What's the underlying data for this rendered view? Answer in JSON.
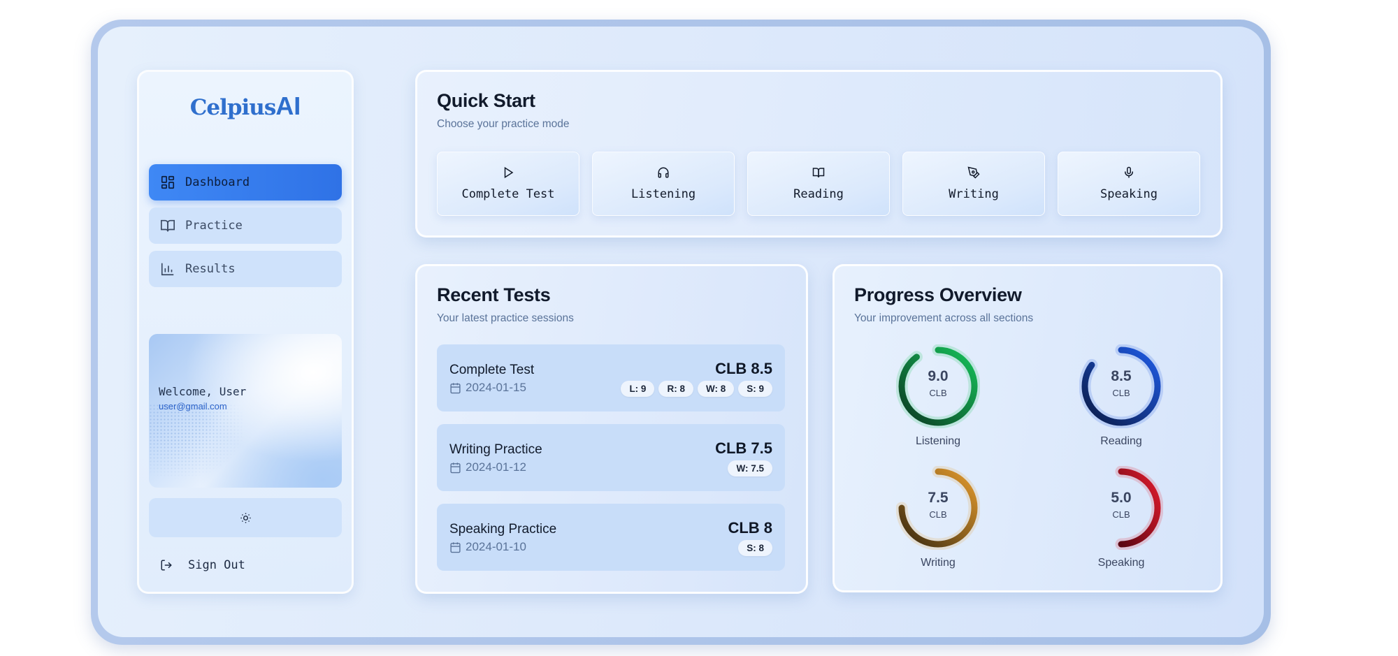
{
  "brand": {
    "logo_main": "Celpius",
    "logo_ai": "AI"
  },
  "sidebar": {
    "items": [
      {
        "label": "Dashboard",
        "icon": "dashboard-icon",
        "active": true
      },
      {
        "label": "Practice",
        "icon": "book-icon",
        "active": false
      },
      {
        "label": "Results",
        "icon": "bar-chart-icon",
        "active": false
      }
    ],
    "user": {
      "welcome": "Welcome, User",
      "email": "user@gmail.com"
    },
    "theme_toggle_icon": "sun-icon",
    "sign_out_label": "Sign Out"
  },
  "quick_start": {
    "title": "Quick Start",
    "subtitle": "Choose your practice mode",
    "modes": [
      {
        "label": "Complete Test",
        "icon": "play-icon"
      },
      {
        "label": "Listening",
        "icon": "headphones-icon"
      },
      {
        "label": "Reading",
        "icon": "book-open-icon"
      },
      {
        "label": "Writing",
        "icon": "pen-icon"
      },
      {
        "label": "Speaking",
        "icon": "microphone-icon"
      }
    ]
  },
  "recent_tests": {
    "title": "Recent Tests",
    "subtitle": "Your latest practice sessions",
    "tests": [
      {
        "name": "Complete Test",
        "date": "2024-01-15",
        "score": "CLB 8.5",
        "badges": [
          "L: 9",
          "R: 8",
          "W: 8",
          "S: 9"
        ]
      },
      {
        "name": "Writing Practice",
        "date": "2024-01-12",
        "score": "CLB 7.5",
        "badges": [
          "W: 7.5"
        ]
      },
      {
        "name": "Speaking Practice",
        "date": "2024-01-10",
        "score": "CLB 8",
        "badges": [
          "S: 8"
        ]
      }
    ]
  },
  "progress_overview": {
    "title": "Progress Overview",
    "subtitle": "Your improvement across all sections",
    "scale_max": 10,
    "sections": [
      {
        "name": "Listening",
        "value": "9.0",
        "score": 9.0,
        "unit": "CLB",
        "color_start": "#0b3a22",
        "color_end": "#16c25a"
      },
      {
        "name": "Reading",
        "value": "8.5",
        "score": 8.5,
        "unit": "CLB",
        "color_start": "#0a1a45",
        "color_end": "#1f5be6"
      },
      {
        "name": "Writing",
        "value": "7.5",
        "score": 7.5,
        "unit": "CLB",
        "color_start": "#3a2a10",
        "color_end": "#e39a2c"
      },
      {
        "name": "Speaking",
        "value": "5.0",
        "score": 5.0,
        "unit": "CLB",
        "color_start": "#5a0612",
        "color_end": "#e11b2d"
      }
    ]
  }
}
